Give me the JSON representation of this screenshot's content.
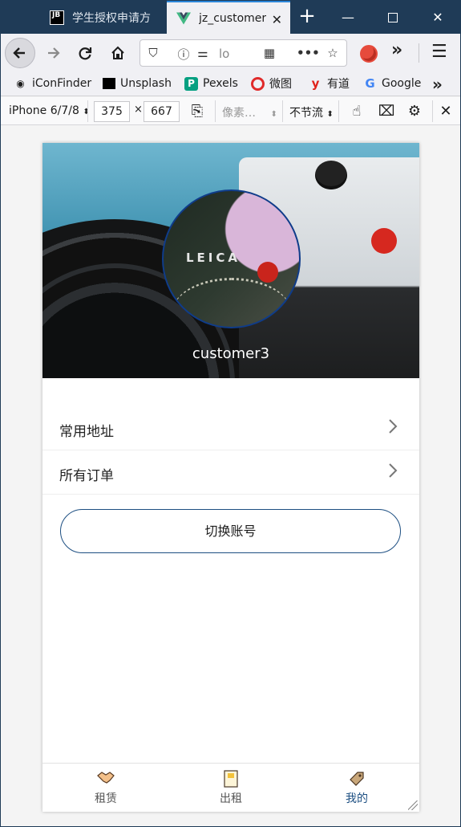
{
  "browser": {
    "tabs": [
      {
        "title": "学生授权申请方",
        "favicon": "jb-icon",
        "active": false
      },
      {
        "title": "jz_customer",
        "favicon": "vue-icon",
        "active": true
      }
    ],
    "new_tab": "+",
    "url_text": "lo",
    "bookmarks": [
      {
        "label": "iConFinder",
        "icon": "iconfinder-icon"
      },
      {
        "label": "Unsplash",
        "icon": "unsplash-icon"
      },
      {
        "label": "Pexels",
        "icon": "pexels-icon"
      },
      {
        "label": "微图",
        "icon": "weitu-icon"
      },
      {
        "label": "有道",
        "icon": "youdao-icon"
      },
      {
        "label": "Google",
        "icon": "google-icon"
      }
    ],
    "rdm": {
      "device": "iPhone 6/7/8",
      "width": "375",
      "times": "×",
      "height": "667",
      "dpr_placeholder": "像素…",
      "throttle": "不节流"
    }
  },
  "app": {
    "banner": {
      "username": "customer3"
    },
    "menu": [
      {
        "label": "常用地址"
      },
      {
        "label": "所有订单"
      }
    ],
    "switch_account": "切换账号",
    "bottom_tabs": [
      {
        "label": "租赁",
        "icon": "handshake-icon",
        "active": false
      },
      {
        "label": "出租",
        "icon": "document-icon",
        "active": false
      },
      {
        "label": "我的",
        "icon": "tag-icon",
        "active": true
      }
    ],
    "accent": "#1d4f82"
  }
}
